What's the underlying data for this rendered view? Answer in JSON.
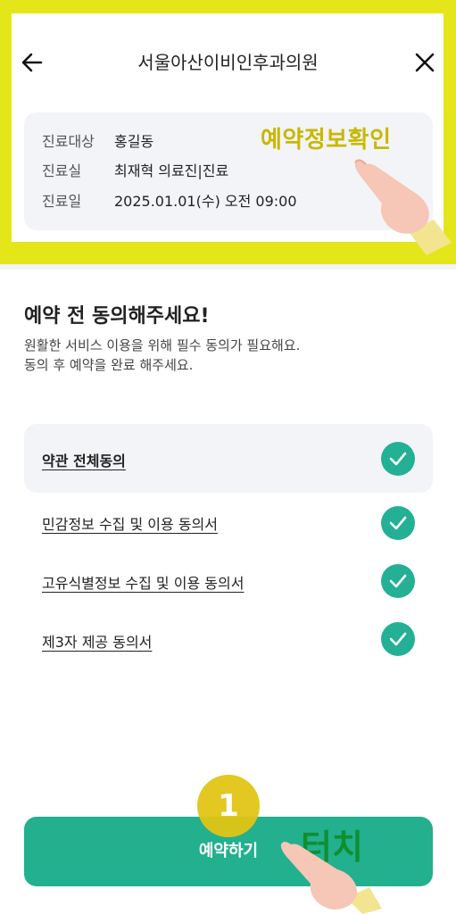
{
  "header": {
    "title": "서울아산이비인후과의원",
    "back_icon": "arrow-left-icon",
    "close_icon": "close-icon"
  },
  "info": {
    "rows": [
      {
        "label": "진료대상",
        "value": "홍길동"
      },
      {
        "label": "진료실",
        "value": "최재혁 의료진|진료"
      },
      {
        "label": "진료일",
        "value": "2025.01.01(수) 오전 09:00"
      }
    ]
  },
  "annotations": {
    "confirm_callout": "예약정보확인",
    "step_number": "1",
    "touch_label": "터치"
  },
  "consent": {
    "heading": "예약 전 동의해주세요!",
    "desc_line1": "원활한 서비스 이용을 위해 필수 동의가 필요해요.",
    "desc_line2": "동의 후 예약을 완료 해주세요.",
    "all_label": "약관 전체동의",
    "items": [
      {
        "label": "민감정보 수집 및 이용 동의서",
        "checked": true
      },
      {
        "label": "고유식별정보 수집 및 이용 동의서",
        "checked": true
      },
      {
        "label": "제3자 제공 동의서",
        "checked": true
      }
    ],
    "all_checked": true
  },
  "footer": {
    "reserve_label": "예약하기"
  },
  "colors": {
    "accent": "#22b08f",
    "highlight": "#e4e61a",
    "callout": "#c9b800",
    "touch": "#0f8f2e"
  }
}
